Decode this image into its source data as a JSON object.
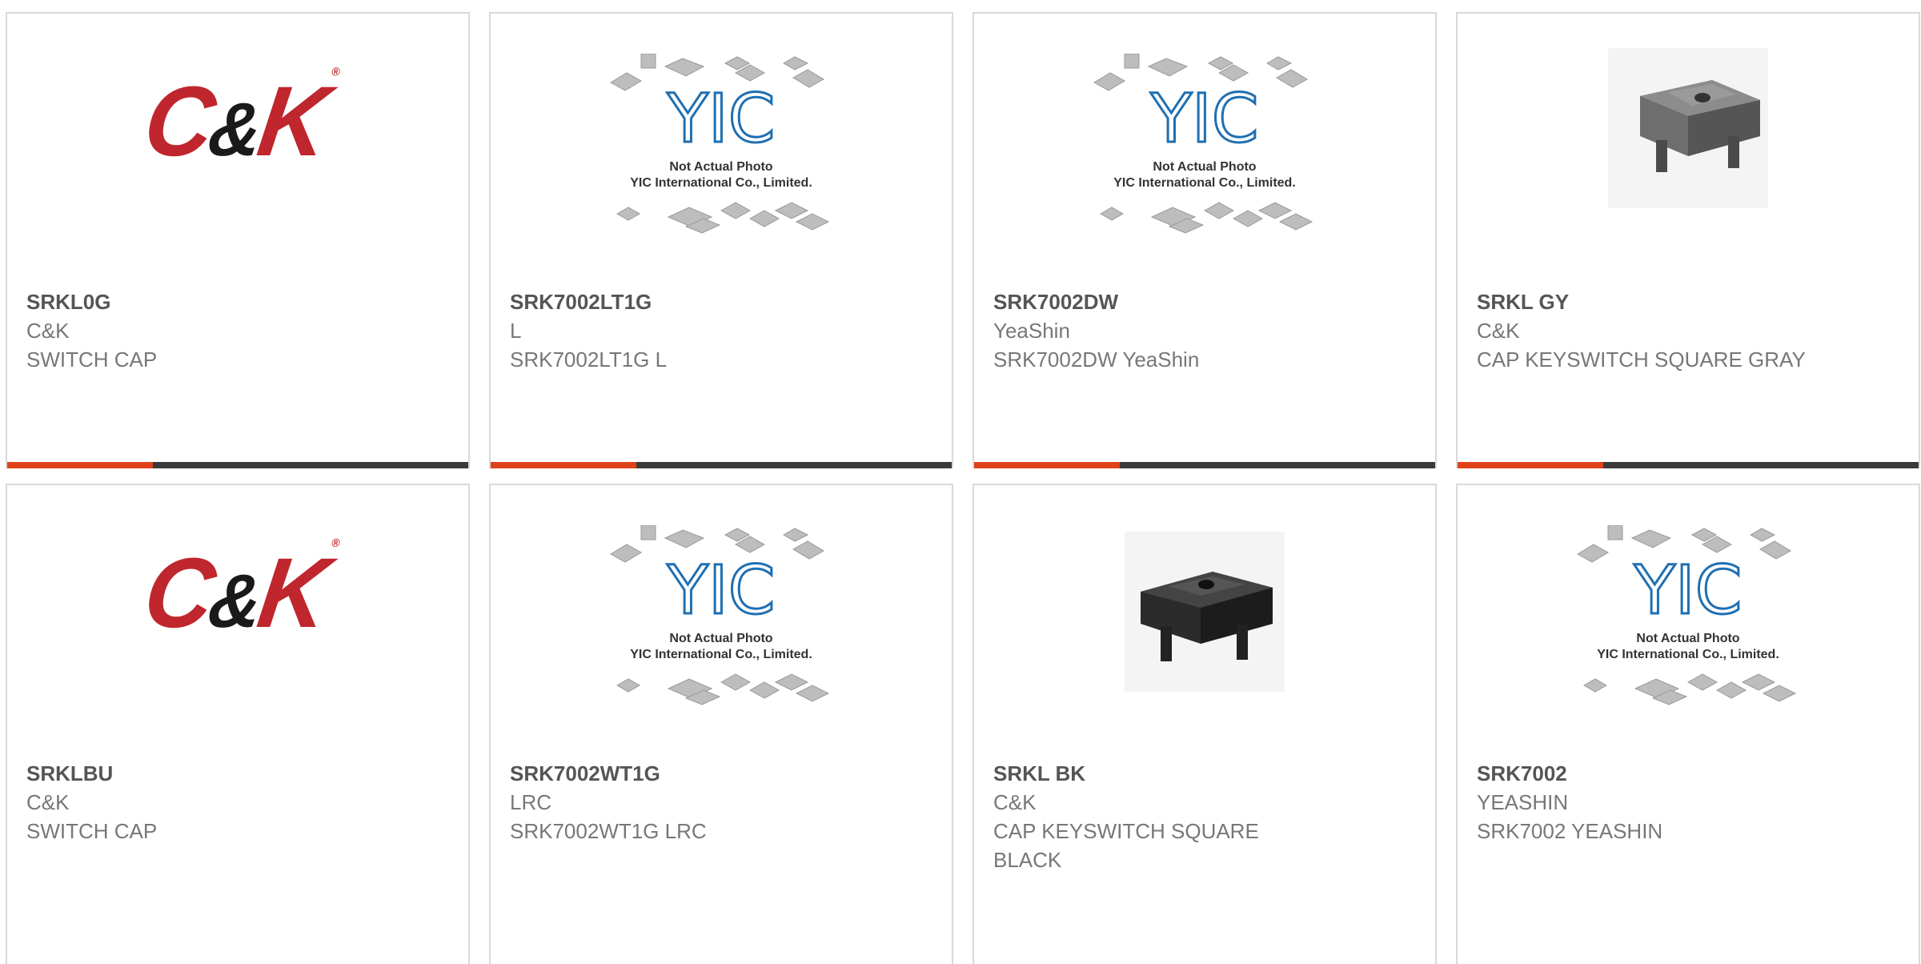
{
  "products": [
    {
      "pn": "SRKL0G",
      "mfr": "C&K",
      "desc": "SWITCH CAP",
      "image": "ck-logo"
    },
    {
      "pn": "SRK7002LT1G",
      "mfr": "L",
      "desc": "SRK7002LT1G L",
      "image": "yic-placeholder"
    },
    {
      "pn": "SRK7002DW",
      "mfr": "YeaShin",
      "desc": "SRK7002DW YeaShin",
      "image": "yic-placeholder"
    },
    {
      "pn": "SRKL GY",
      "mfr": "C&K",
      "desc": "CAP KEYSWITCH SQUARE GRAY",
      "image": "keycap-gray"
    },
    {
      "pn": "SRKLBU",
      "mfr": "C&K",
      "desc": "SWITCH CAP",
      "image": "ck-logo"
    },
    {
      "pn": "SRK7002WT1G",
      "mfr": "LRC",
      "desc": "SRK7002WT1G LRC",
      "image": "yic-placeholder"
    },
    {
      "pn": "SRKL BK",
      "mfr": "C&K",
      "desc": "CAP KEYSWITCH SQUARE BLACK",
      "image": "keycap-black"
    },
    {
      "pn": "SRK7002",
      "mfr": "YEASHIN",
      "desc": "SRK7002 YEASHIN",
      "image": "yic-placeholder"
    }
  ],
  "placeholder": {
    "brand": "YIC",
    "line1": "Not Actual Photo",
    "line2": "YIC International Co., Limited."
  },
  "logo": {
    "text_c": "C",
    "text_amp": "&",
    "text_k": "K",
    "reg": "®"
  },
  "colors": {
    "accent": "#e0421b",
    "bar": "#3a3a3a",
    "logo_red": "#c0262d",
    "yic_blue": "#1f6fb2"
  }
}
